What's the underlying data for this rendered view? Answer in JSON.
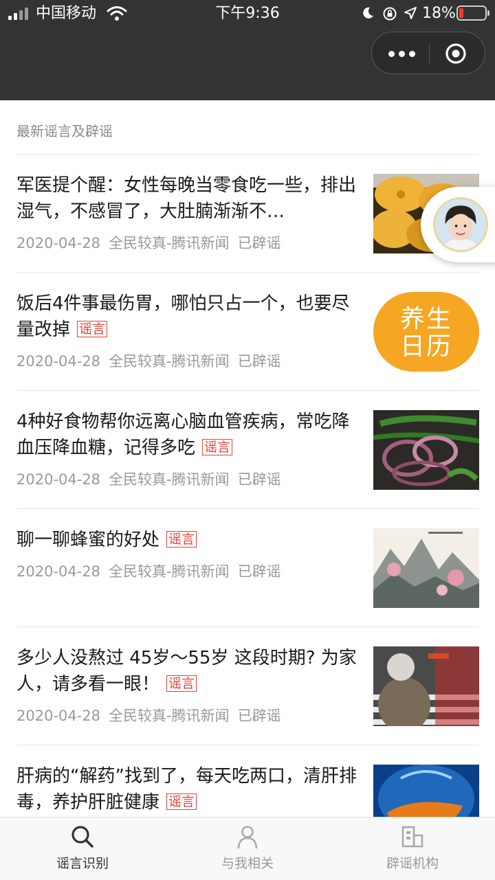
{
  "status_bar": {
    "carrier": "中国移动",
    "time": "下午9:36",
    "battery_percent_label": "18%",
    "battery_level": 0.18,
    "icons": [
      "signal-icon",
      "wifi-icon",
      "moon-icon",
      "rotation-lock-icon",
      "location-arrow-icon",
      "battery-icon"
    ]
  },
  "nav": {
    "menu_icon": "more-dots-icon",
    "close_icon": "target-circle-icon"
  },
  "section_title": "最新谣言及辟谣",
  "news": [
    {
      "title": "军医提个醒：女性每晚当零食吃一些，排出湿气，不感冒了，大肚腩渐渐不…",
      "tag": "",
      "date": "2020-04-28",
      "source": "全民较真-腾讯新闻",
      "status": "已辟谣",
      "thumbnail": "dried-pineapple-photo"
    },
    {
      "title": "饭后4件事最伤胃，哪怕只占一个，也要尽量改掉",
      "tag": "谣言",
      "date": "2020-04-28",
      "source": "全民较真-腾讯新闻",
      "status": "已辟谣",
      "thumbnail": "yangsheng-rili-badge",
      "thumbnail_text": "养生日历",
      "thumbnail_color": "#f5a623"
    },
    {
      "title": "4种好食物帮你远离心脑血管疾病，常吃降血压降血糖，记得多吃",
      "tag": "谣言",
      "date": "2020-04-28",
      "source": "全民较真-腾讯新闻",
      "status": "已辟谣",
      "thumbnail": "onion-pepper-dish-photo"
    },
    {
      "title": "聊一聊蜂蜜的好处",
      "tag": "谣言",
      "date": "2020-04-28",
      "source": "全民较真-腾讯新闻",
      "status": "已辟谣",
      "thumbnail": "ink-landscape-painting"
    },
    {
      "title": "多少人没熬过 45岁～55岁 这段时期? 为家人，请多看一眼！",
      "tag": "谣言",
      "date": "2020-04-28",
      "source": "全民较真-腾讯新闻",
      "status": "已辟谣",
      "thumbnail": "elderly-crosswalk-photo"
    },
    {
      "title": "肝病的“解药”找到了，每天吃两口，清肝排毒，养护肝脏健康",
      "tag": "谣言",
      "date": "",
      "source": "",
      "status": "",
      "thumbnail": "liver-anatomy-image"
    }
  ],
  "floating_button": {
    "icon": "avatar-girl-photo"
  },
  "tabbar": {
    "items": [
      {
        "label": "谣言识别",
        "icon": "search-icon",
        "active": true
      },
      {
        "label": "与我相关",
        "icon": "user-icon",
        "active": false
      },
      {
        "label": "辟谣机构",
        "icon": "building-icon",
        "active": false
      }
    ]
  },
  "colors": {
    "header_bg": "#333333",
    "tag_red": "#e5413a",
    "meta_gray": "#999999",
    "title_text": "#1a1a1a"
  }
}
